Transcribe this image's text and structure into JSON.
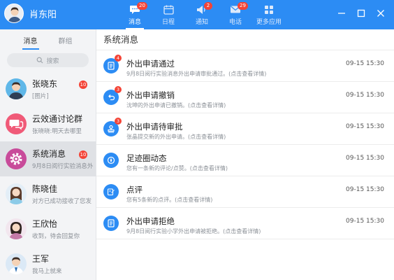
{
  "header": {
    "username": "肖东阳",
    "nav": [
      {
        "label": "消息",
        "badge": "20",
        "active": true
      },
      {
        "label": "日程",
        "badge": ""
      },
      {
        "label": "通知",
        "badge": "2"
      },
      {
        "label": "电话",
        "badge": "29"
      },
      {
        "label": "更多应用",
        "badge": ""
      }
    ]
  },
  "sidebar": {
    "tabs": [
      "消息",
      "群组"
    ],
    "search_placeholder": "搜索",
    "conversations": [
      {
        "name": "张晓东",
        "preview": "[图片]",
        "badge": "10"
      },
      {
        "name": "云效通讨论群",
        "preview": "张晓晓:明天去哪里",
        "badge": ""
      },
      {
        "name": "系统消息",
        "preview": "9月8日阅行实验消息外",
        "badge": "10"
      },
      {
        "name": "陈晓佳",
        "preview": "对方已成功接收了您发",
        "badge": ""
      },
      {
        "name": "王欣怡",
        "preview": "收到，待会回复你",
        "badge": ""
      },
      {
        "name": "王军",
        "preview": "我马上就来",
        "badge": ""
      }
    ]
  },
  "main": {
    "title": "系统消息",
    "messages": [
      {
        "title": "外出申请通过",
        "desc": "9月8日阅行实验消息外出申请审批通过。(点击查看详情)",
        "time": "09-15  15:30",
        "badge": "4",
        "icon": "document-icon"
      },
      {
        "title": "外出申请撤销",
        "desc": "沈坤的外出申请已撤销。(点击查看详情)",
        "time": "09-15  15:30",
        "badge": "3",
        "icon": "undo-icon"
      },
      {
        "title": "外出申请待审批",
        "desc": "张晶提交新的外出申请。(点击查看详情)",
        "time": "09-15  15:30",
        "badge": "3",
        "icon": "stamp-icon"
      },
      {
        "title": "足迹圈动态",
        "desc": "您有一条新的评论/点赞。(点击查看详情)",
        "time": "09-15  15:30",
        "badge": "",
        "icon": "compass-icon"
      },
      {
        "title": "点评",
        "desc": "您有5条新的点评。(点击查看详情)",
        "time": "09-15  15:30",
        "badge": "",
        "icon": "edit-icon"
      },
      {
        "title": "外出申请拒绝",
        "desc": "9月8日阅行实验小学外出申请被拒绝。(点击查看详情)",
        "time": "09-15  15:30",
        "badge": "",
        "icon": "document-icon"
      }
    ]
  },
  "colors": {
    "accent": "#2c8cf4",
    "badge": "#f44336"
  }
}
